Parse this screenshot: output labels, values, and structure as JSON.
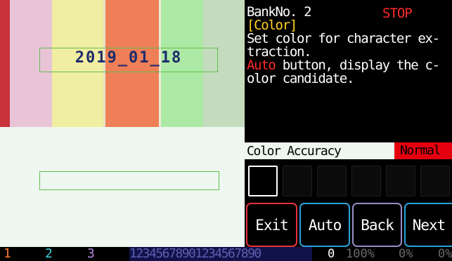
{
  "camera": {
    "date_text": "2019_01_18",
    "stripe_colors": [
      "#c9313b",
      "#e9c4d7",
      "#f0eea0",
      "#e9e1c9",
      "#ee7f56",
      "#efeadc",
      "#ace9a4",
      "#c4dcbd"
    ]
  },
  "panel": {
    "bank_no": "BankNo. 2",
    "state": "STOP",
    "mode": "[Color]",
    "description_line1": "Set color for character ex-",
    "description_line2": "traction.",
    "auto_word": "Auto",
    "description_line3_rest": " button, display the c-",
    "description_line4": "olor candidate."
  },
  "accuracy": {
    "label": "Color Accuracy",
    "value": "Normal",
    "value_color": "#e50010"
  },
  "swatches": [
    {
      "selected": true
    },
    {
      "selected": false
    },
    {
      "selected": false
    },
    {
      "selected": false
    },
    {
      "selected": false
    },
    {
      "selected": false
    }
  ],
  "buttons": {
    "exit": "Exit",
    "auto": "Auto",
    "back": "Back",
    "next": "Next"
  },
  "statusbar": {
    "bank1": "1",
    "bank2": "2",
    "bank3": "3",
    "digits": "12345678901234567890",
    "count": "0",
    "percent1": "100%",
    "percent2": "0%",
    "percent3": "0%"
  },
  "colors": {
    "exit_border": "#e8323a",
    "auto_border": "#2aa2dc",
    "back_border": "#9b8cc6",
    "next_border": "#2aa2dc",
    "state_color": "#ff2a2a",
    "mode_color": "#ffd21f",
    "roi_border": "#5fbf4a"
  }
}
